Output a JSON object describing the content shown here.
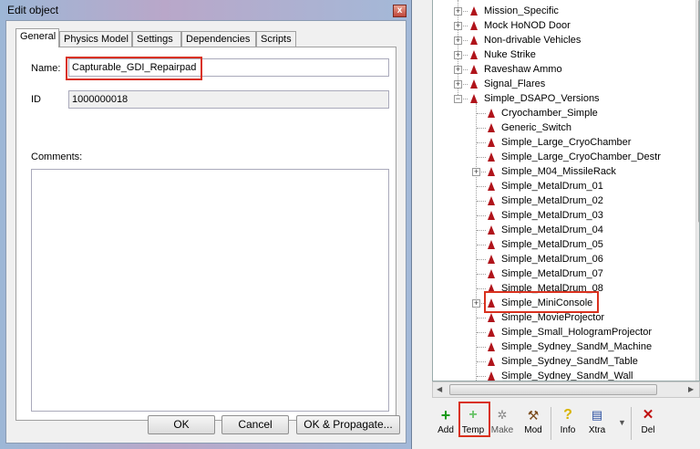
{
  "dialog": {
    "title": "Edit object",
    "close_glyph": "x",
    "tabs": [
      "General",
      "Physics Model",
      "Settings",
      "Dependencies",
      "Scripts"
    ],
    "name_label": "Name:",
    "name_value": "Capturable_GDI_Repairpad",
    "id_label": "ID",
    "id_value": "1000000018",
    "comments_label": "Comments:",
    "comments_value": "",
    "ok_label": "OK",
    "cancel_label": "Cancel",
    "ok_propagate_label": "OK & Propagate..."
  },
  "tree": {
    "parents": [
      {
        "label": "Mission_Specific",
        "expander": "+"
      },
      {
        "label": "Mock HoNOD Door",
        "expander": "+"
      },
      {
        "label": "Non-drivable Vehicles",
        "expander": "+"
      },
      {
        "label": "Nuke Strike",
        "expander": "+"
      },
      {
        "label": "Raveshaw Ammo",
        "expander": "+"
      },
      {
        "label": "Signal_Flares",
        "expander": "+"
      },
      {
        "label": "Simple_DSAPO_Versions",
        "expander": "−"
      }
    ],
    "children": [
      {
        "label": "Cryochamber_Simple",
        "expander": ""
      },
      {
        "label": "Generic_Switch",
        "expander": ""
      },
      {
        "label": "Simple_Large_CryoChamber",
        "expander": ""
      },
      {
        "label": "Simple_Large_CryoChamber_Destr",
        "expander": ""
      },
      {
        "label": "Simple_M04_MissileRack",
        "expander": "+"
      },
      {
        "label": "Simple_MetalDrum_01",
        "expander": ""
      },
      {
        "label": "Simple_MetalDrum_02",
        "expander": ""
      },
      {
        "label": "Simple_MetalDrum_03",
        "expander": ""
      },
      {
        "label": "Simple_MetalDrum_04",
        "expander": ""
      },
      {
        "label": "Simple_MetalDrum_05",
        "expander": ""
      },
      {
        "label": "Simple_MetalDrum_06",
        "expander": ""
      },
      {
        "label": "Simple_MetalDrum_07",
        "expander": ""
      },
      {
        "label": "Simple_MetalDrum_08",
        "expander": ""
      },
      {
        "label": "Simple_MiniConsole",
        "expander": "+"
      },
      {
        "label": "Simple_MovieProjector",
        "expander": ""
      },
      {
        "label": "Simple_Small_HologramProjector",
        "expander": ""
      },
      {
        "label": "Simple_Sydney_SandM_Machine",
        "expander": ""
      },
      {
        "label": "Simple_Sydney_SandM_Table",
        "expander": ""
      },
      {
        "label": "Simple_Sydney_SandM_Wall",
        "expander": ""
      }
    ]
  },
  "toolbar": {
    "add_label": "Add",
    "temp_label": "Temp",
    "make_label": "Make",
    "mod_label": "Mod",
    "info_label": "Info",
    "xtra_label": "Xtra",
    "del_label": "Del"
  },
  "colors": {
    "highlight": "#d9311e",
    "tree_icon": "#b0141b",
    "add_icon": "#1a9a1a",
    "del_icon": "#c01010"
  }
}
